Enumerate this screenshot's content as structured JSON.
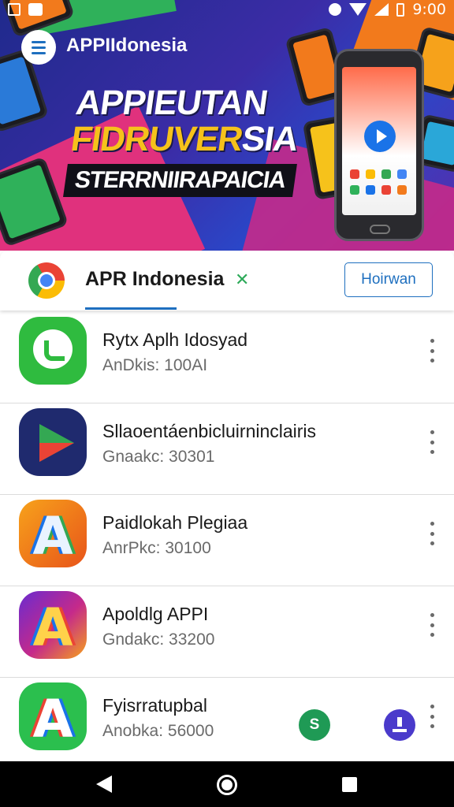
{
  "status_bar": {
    "time": "9:00",
    "left_icons": [
      "notification-n-icon",
      "notification-box-icon"
    ],
    "right_icons": [
      "wifi-icon",
      "signal-icon",
      "battery-icon"
    ]
  },
  "hero": {
    "brand": "APPIIdonesia",
    "headline_line1": "APPIEUTAN",
    "headline_line2_yellow": "FIDRUVER",
    "headline_line2_white": "SIA",
    "headline_line3": "STERRNIIRAPAICIA"
  },
  "header": {
    "title": "APR Indonesia",
    "mark": "✕",
    "button_label": "Hoirwan"
  },
  "apps": [
    {
      "name": "Rytx Aplh Idosyad",
      "sub": "AnDkis:  100AI"
    },
    {
      "name": "Sllaoentáenbicluirninclairis",
      "sub": "Gnaakc: 30301"
    },
    {
      "name": "Paidlokah Plegiaa",
      "sub": "AnrPkc: 30100"
    },
    {
      "name": "Apoldlg APPI",
      "sub": "Gndakc: 33200"
    },
    {
      "name": "Fyisrratupbal",
      "sub": "Anobka: 56000"
    }
  ],
  "fab": {
    "green_label": "S"
  },
  "colors": {
    "accent": "#1e6fbf",
    "hero_bg": "#2a3aa8",
    "green": "#1f9a55",
    "purple": "#4a3acb"
  }
}
